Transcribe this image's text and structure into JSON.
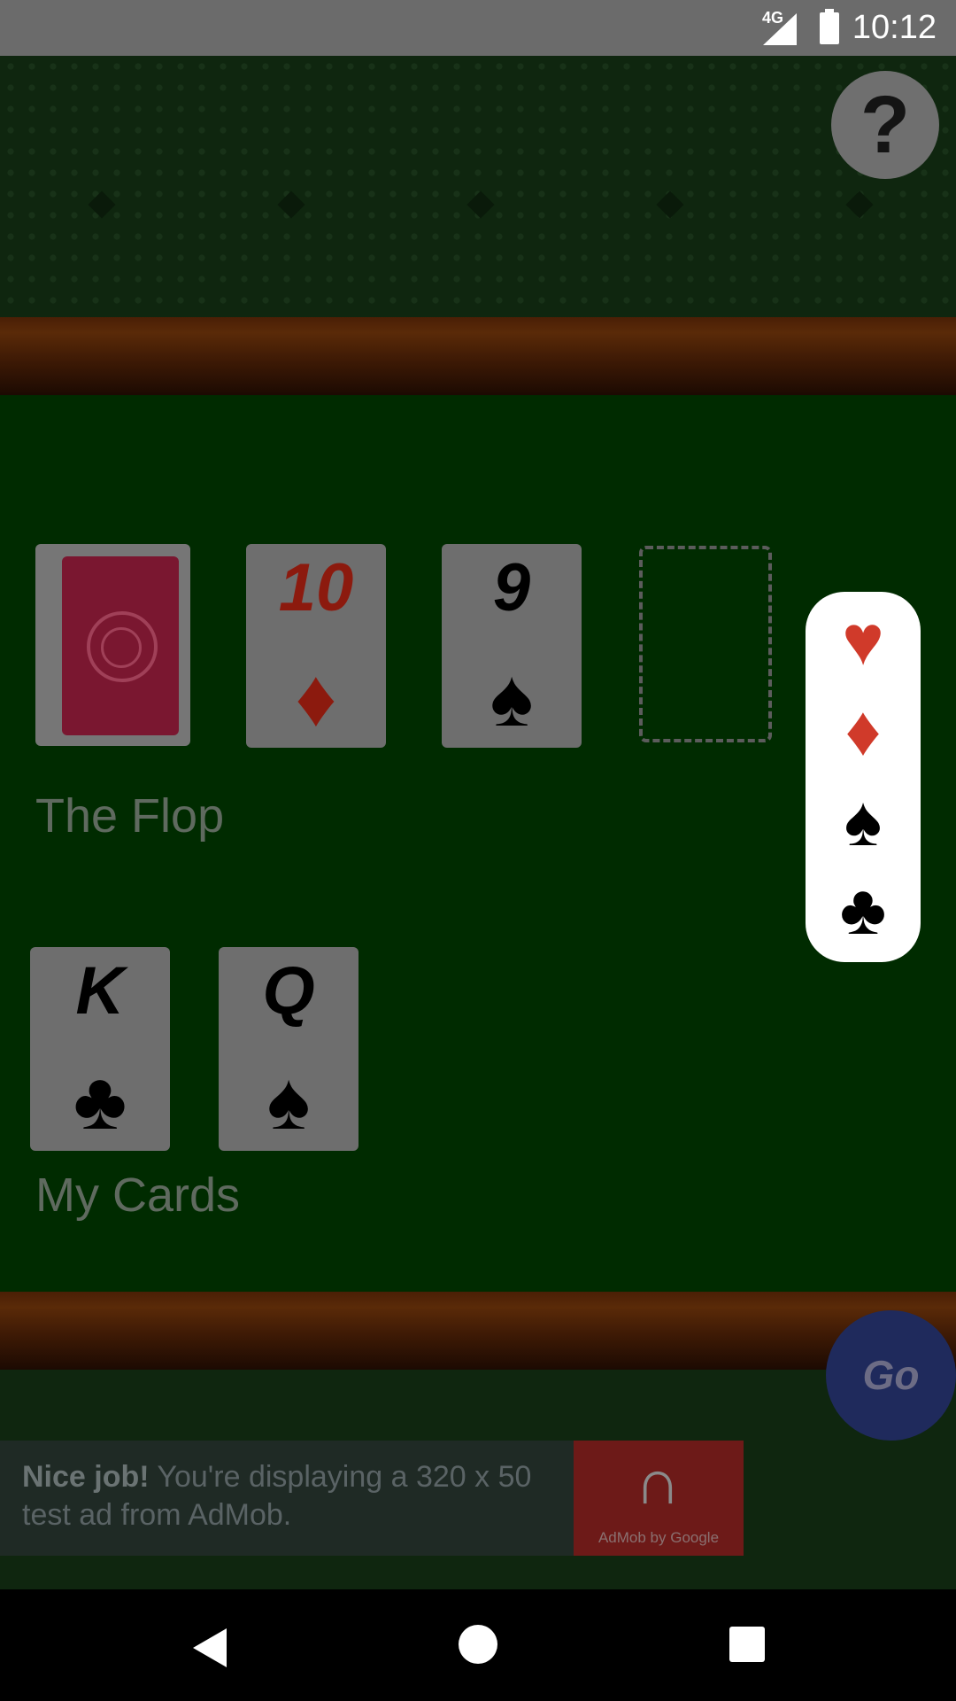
{
  "status_bar": {
    "network": "4G",
    "time": "10:12"
  },
  "help_button": {
    "label": "?"
  },
  "flop": {
    "label": "The Flop",
    "cards": [
      {
        "rank": "10",
        "suit": "♦",
        "color": "red"
      },
      {
        "rank": "9",
        "suit": "♠",
        "color": "black"
      }
    ]
  },
  "my_cards": {
    "label": "My Cards",
    "cards": [
      {
        "rank": "K",
        "suit": "♣",
        "color": "black"
      },
      {
        "rank": "Q",
        "suit": "♠",
        "color": "black"
      }
    ]
  },
  "suit_picker": {
    "suits": [
      {
        "glyph": "♥",
        "icon": "heart-icon",
        "color": "#d03a2a"
      },
      {
        "glyph": "♦",
        "icon": "diamond-icon",
        "color": "#d03a2a"
      },
      {
        "glyph": "♠",
        "icon": "spade-icon",
        "color": "#000000"
      },
      {
        "glyph": "♣",
        "icon": "club-icon",
        "color": "#000000"
      }
    ]
  },
  "go_button": {
    "label": "Go"
  },
  "ad": {
    "bold": "Nice job!",
    "text": " You're displaying a 320 x 50 test ad from AdMob.",
    "logo_caption": "AdMob by Google"
  },
  "colors": {
    "table_felt": "#002b00",
    "rail": "#4a1f06",
    "go_button": "#1f2a5c"
  }
}
